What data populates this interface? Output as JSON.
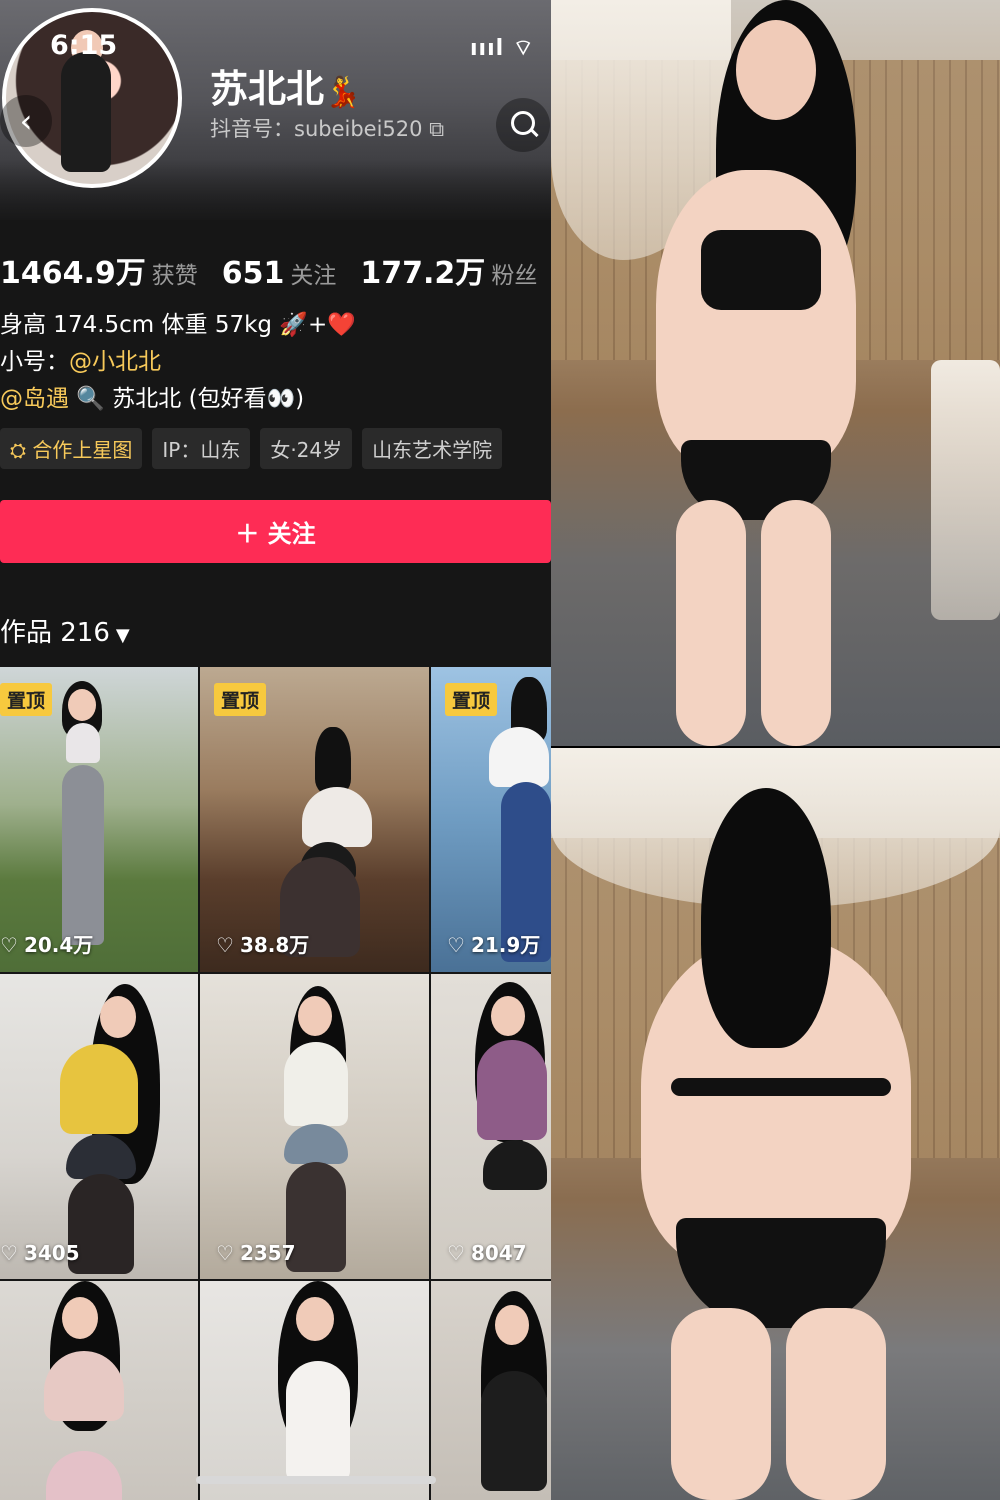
{
  "status_bar": {
    "time": "6:15",
    "signal": "ıııl ⌔"
  },
  "profile": {
    "name": "苏北北",
    "name_emoji": "💃",
    "douyin_id": "抖音号：subeibei520 ⧉"
  },
  "stats": [
    {
      "value": "1464.9万",
      "label": "获赞"
    },
    {
      "value": "651",
      "label": "关注"
    },
    {
      "value": "177.2万",
      "label": "粉丝"
    }
  ],
  "bio": {
    "line1": "身高 174.5cm 体重 57kg 🚀+❤️",
    "line2_prefix": "小号：",
    "line2_link": "@小北北",
    "line3_link": "@岛遇",
    "line3_rest": " 🔍 苏北北 (包好看👀)"
  },
  "tags": [
    "⛭ 合作上星图",
    "IP：山东",
    "女·24岁",
    "山东艺术学院"
  ],
  "follow_button": "＋ 关注",
  "works": {
    "label": "作品 216",
    "caret": "▼"
  },
  "pin_label": "置顶",
  "videos": [
    {
      "likes": "20.4万",
      "pinned": true
    },
    {
      "likes": "38.8万",
      "pinned": true
    },
    {
      "likes": "21.9万",
      "pinned": true
    },
    {
      "likes": "3405",
      "pinned": false
    },
    {
      "likes": "2357",
      "pinned": false
    },
    {
      "likes": "8047",
      "pinned": false
    },
    {
      "likes": "",
      "pinned": false
    },
    {
      "likes": "",
      "pinned": false
    },
    {
      "likes": "",
      "pinned": false
    }
  ],
  "icons": {
    "back": "‹",
    "heart": "♡"
  },
  "colors": {
    "follow": "#fe2c55",
    "pin": "#f7c93e",
    "link": "#f7c95a"
  }
}
